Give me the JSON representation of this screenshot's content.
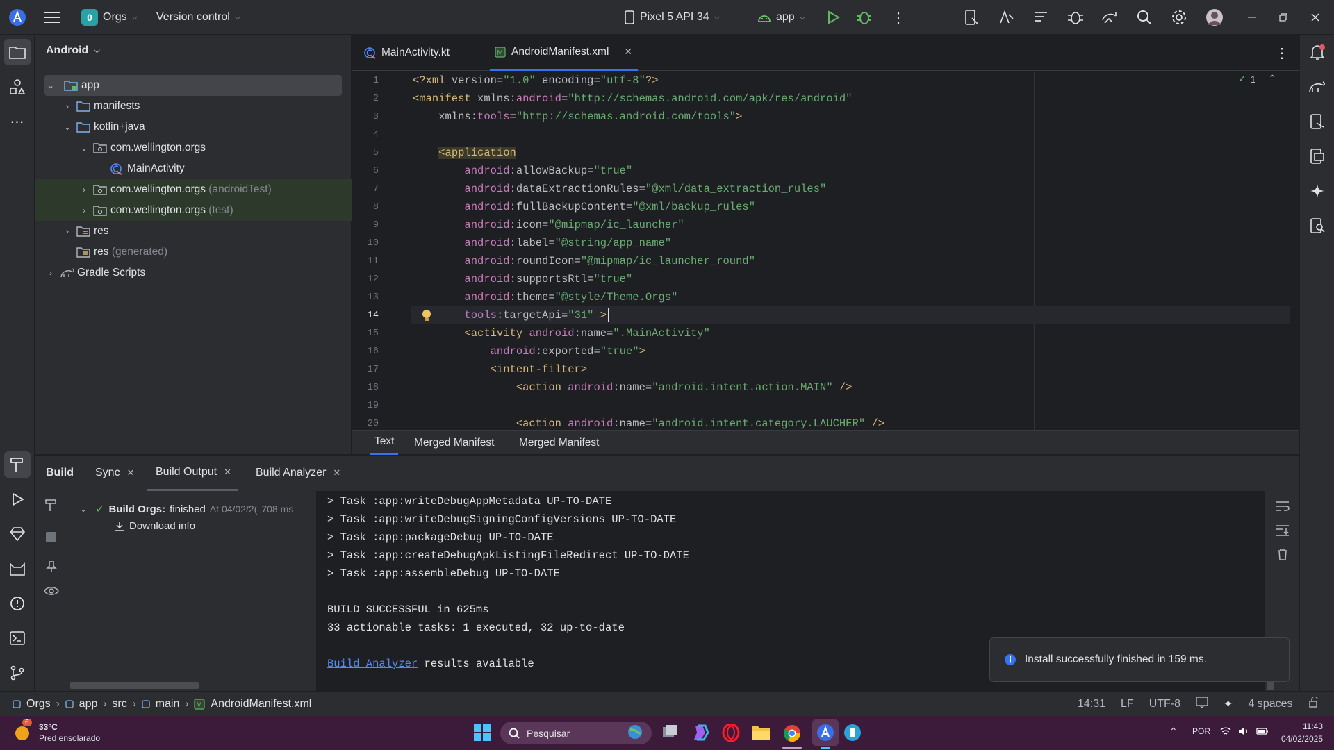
{
  "titlebar": {
    "project_badge": "0",
    "project_name": "Orgs",
    "vcs": "Version control",
    "device": "Pixel 5 API 34",
    "run_config": "app"
  },
  "project_panel": {
    "view_selector": "Android",
    "tree": [
      {
        "label": "app",
        "suffix": ""
      },
      {
        "label": "manifests",
        "suffix": ""
      },
      {
        "label": "kotlin+java",
        "suffix": ""
      },
      {
        "label": "com.wellington.orgs",
        "suffix": ""
      },
      {
        "label": "MainActivity",
        "suffix": ""
      },
      {
        "label": "com.wellington.orgs",
        "suffix": "(androidTest)"
      },
      {
        "label": "com.wellington.orgs",
        "suffix": "(test)"
      },
      {
        "label": "res",
        "suffix": ""
      },
      {
        "label": "res",
        "suffix": "(generated)"
      },
      {
        "label": "Gradle Scripts",
        "suffix": ""
      }
    ]
  },
  "editor": {
    "tabs": [
      {
        "label": "MainActivity.kt"
      },
      {
        "label": "AndroidManifest.xml"
      }
    ],
    "inspection_count": "1",
    "line_numbers": [
      "1",
      "2",
      "3",
      "4",
      "5",
      "6",
      "7",
      "8",
      "9",
      "10",
      "11",
      "12",
      "13",
      "14",
      "15",
      "16",
      "17",
      "18",
      "19",
      "20"
    ],
    "lines": [
      [
        {
          "c": "t",
          "v": "<?xml "
        },
        {
          "c": "a",
          "v": "version="
        },
        {
          "c": "s",
          "v": "\"1.0\""
        },
        {
          "c": "a",
          "v": " encoding="
        },
        {
          "c": "s",
          "v": "\"utf-8\""
        },
        {
          "c": "t",
          "v": "?>"
        }
      ],
      [
        {
          "c": "t",
          "v": "<manifest "
        },
        {
          "c": "a",
          "v": "xmlns:"
        },
        {
          "c": "ns",
          "v": "android"
        },
        {
          "c": "a",
          "v": "="
        },
        {
          "c": "s",
          "v": "\"http://schemas.android.com/apk/res/android\""
        }
      ],
      [
        {
          "c": "a",
          "v": "    xmlns:"
        },
        {
          "c": "ns",
          "v": "tools"
        },
        {
          "c": "a",
          "v": "="
        },
        {
          "c": "s",
          "v": "\"http://schemas.android.com/tools\""
        },
        {
          "c": "t",
          "v": ">"
        }
      ],
      [],
      [
        {
          "c": "a",
          "v": "    "
        },
        {
          "c": "t",
          "v": "<application"
        }
      ],
      [
        {
          "c": "a",
          "v": "        "
        },
        {
          "c": "ns",
          "v": "android"
        },
        {
          "c": "a",
          "v": ":allowBackup="
        },
        {
          "c": "s",
          "v": "\"true\""
        }
      ],
      [
        {
          "c": "a",
          "v": "        "
        },
        {
          "c": "ns",
          "v": "android"
        },
        {
          "c": "a",
          "v": ":dataExtractionRules="
        },
        {
          "c": "s",
          "v": "\"@xml/data_extraction_rules\""
        }
      ],
      [
        {
          "c": "a",
          "v": "        "
        },
        {
          "c": "ns",
          "v": "android"
        },
        {
          "c": "a",
          "v": ":fullBackupContent="
        },
        {
          "c": "s",
          "v": "\"@xml/backup_rules\""
        }
      ],
      [
        {
          "c": "a",
          "v": "        "
        },
        {
          "c": "ns",
          "v": "android"
        },
        {
          "c": "a",
          "v": ":icon="
        },
        {
          "c": "s",
          "v": "\"@mipmap/ic_launcher\""
        }
      ],
      [
        {
          "c": "a",
          "v": "        "
        },
        {
          "c": "ns",
          "v": "android"
        },
        {
          "c": "a",
          "v": ":label="
        },
        {
          "c": "s",
          "v": "\"@string/app_name\""
        }
      ],
      [
        {
          "c": "a",
          "v": "        "
        },
        {
          "c": "ns",
          "v": "android"
        },
        {
          "c": "a",
          "v": ":roundIcon="
        },
        {
          "c": "s",
          "v": "\"@mipmap/ic_launcher_round\""
        }
      ],
      [
        {
          "c": "a",
          "v": "        "
        },
        {
          "c": "ns",
          "v": "android"
        },
        {
          "c": "a",
          "v": ":supportsRtl="
        },
        {
          "c": "s",
          "v": "\"true\""
        }
      ],
      [
        {
          "c": "a",
          "v": "        "
        },
        {
          "c": "ns",
          "v": "android"
        },
        {
          "c": "a",
          "v": ":theme="
        },
        {
          "c": "s",
          "v": "\"@style/Theme.Orgs\""
        }
      ],
      [
        {
          "c": "a",
          "v": "        "
        },
        {
          "c": "ns",
          "v": "tools"
        },
        {
          "c": "a",
          "v": ":targetApi="
        },
        {
          "c": "s",
          "v": "\"31\""
        },
        {
          "c": "t",
          "v": " >"
        }
      ],
      [
        {
          "c": "a",
          "v": "        "
        },
        {
          "c": "t",
          "v": "<activity "
        },
        {
          "c": "ns",
          "v": "android"
        },
        {
          "c": "a",
          "v": ":name="
        },
        {
          "c": "s",
          "v": "\".MainActivity\""
        }
      ],
      [
        {
          "c": "a",
          "v": "            "
        },
        {
          "c": "ns",
          "v": "android"
        },
        {
          "c": "a",
          "v": ":exported="
        },
        {
          "c": "s",
          "v": "\"true\""
        },
        {
          "c": "t",
          "v": ">"
        }
      ],
      [
        {
          "c": "a",
          "v": "            "
        },
        {
          "c": "t",
          "v": "<intent-filter>"
        }
      ],
      [
        {
          "c": "a",
          "v": "                "
        },
        {
          "c": "t",
          "v": "<action "
        },
        {
          "c": "ns",
          "v": "android"
        },
        {
          "c": "a",
          "v": ":name="
        },
        {
          "c": "s",
          "v": "\"android.intent.action.MAIN\""
        },
        {
          "c": "t",
          "v": " />"
        }
      ],
      [],
      [
        {
          "c": "a",
          "v": "                "
        },
        {
          "c": "t",
          "v": "<action "
        },
        {
          "c": "ns",
          "v": "android"
        },
        {
          "c": "a",
          "v": ":name="
        },
        {
          "c": "s",
          "v": "\"android.intent.category.LAUCHER\""
        },
        {
          "c": "t",
          "v": " />"
        }
      ]
    ],
    "bottom_tabs": [
      "Text",
      "Merged Manifest",
      "Merged Manifest"
    ]
  },
  "build": {
    "tabs": [
      "Build",
      "Sync",
      "Build Output",
      "Build Analyzer"
    ],
    "tree_title": "Build Orgs:",
    "tree_status": "finished",
    "tree_time": "At 04/02/2(",
    "tree_duration": "708 ms",
    "download_info": "Download info",
    "console": [
      "> Task :app:writeDebugAppMetadata UP-TO-DATE",
      "> Task :app:writeDebugSigningConfigVersions UP-TO-DATE",
      "> Task :app:packageDebug UP-TO-DATE",
      "> Task :app:createDebugApkListingFileRedirect UP-TO-DATE",
      "> Task :app:assembleDebug UP-TO-DATE",
      "",
      "BUILD SUCCESSFUL in 625ms",
      "33 actionable tasks: 1 executed, 32 up-to-date",
      ""
    ],
    "analyzer_link": "Build Analyzer",
    "analyzer_rest": " results available"
  },
  "toast": {
    "message": "Install successfully finished in 159 ms."
  },
  "statusbar": {
    "breadcrumb": [
      "Orgs",
      "app",
      "src",
      "main",
      "AndroidManifest.xml"
    ],
    "position": "14:31",
    "line_sep": "LF",
    "encoding": "UTF-8",
    "indent": "4 spaces"
  },
  "taskbar": {
    "weather_badge": "6",
    "temperature": "33°C",
    "weather": "Pred ensolarado",
    "search": "Pesquisar",
    "lang": "POR",
    "time": "11:43",
    "date": "04/02/2025"
  }
}
